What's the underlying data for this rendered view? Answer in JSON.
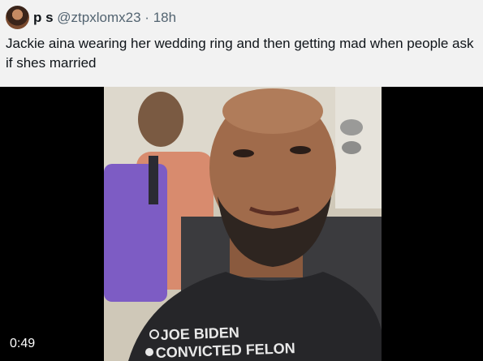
{
  "post": {
    "display_name": "p s",
    "handle": "@ztpxlomx23",
    "separator": "·",
    "time": "18h",
    "text": "Jackie aina wearing her wedding ring and then getting mad when people ask if shes married"
  },
  "video": {
    "duration": "0:49",
    "shirt_line_1": "JOE BIDEN",
    "shirt_line_2": "CONVICTED FELON"
  }
}
